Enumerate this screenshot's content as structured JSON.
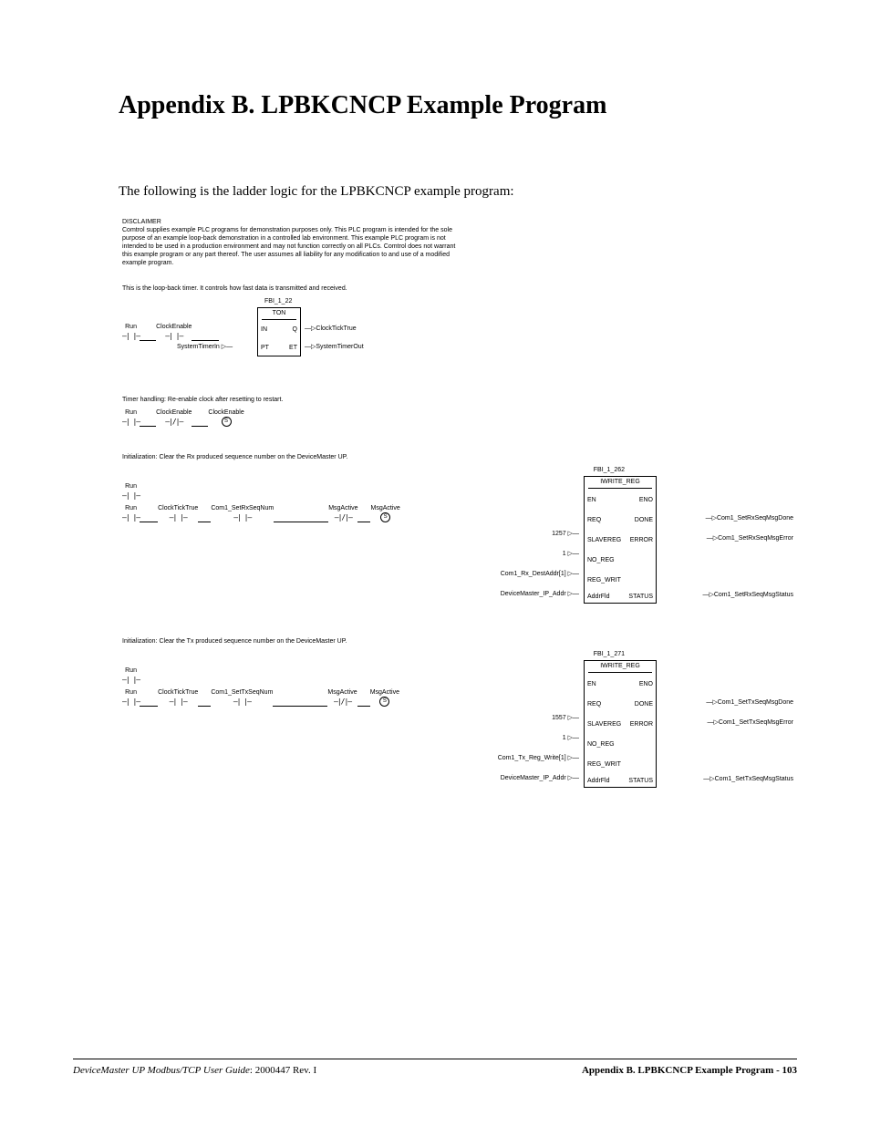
{
  "title": "Appendix B. LPBKCNCP Example Program",
  "intro": "The following is the ladder logic for the LPBKCNCP example program:",
  "disclaimer": {
    "heading": "DISCLAIMER",
    "body": "Comtrol supplies example PLC programs for demonstration purposes only. This PLC program is intended for the sole purpose of an example loop-back demonstration in a controlled lab environment. This example PLC program is not intended to be used in a production environment and may not function correctly on all PLCs. Comtrol does not warrant this example program or any part thereof. The user assumes all liability for any modification to and use of a modified example program."
  },
  "timer_rung": {
    "desc": "This is the loop-back timer. It controls how fast data is transmitted and received.",
    "fbi": "FBI_1_22",
    "type": "TON",
    "contacts": [
      "Run",
      "ClockEnable"
    ],
    "pins_left": [
      "IN",
      "PT"
    ],
    "pins_right": [
      "Q",
      "ET"
    ],
    "inputs_left_ext": [
      "SystemTimerIn"
    ],
    "outputs": [
      "ClockTickTrue",
      "SystemTimerOut"
    ]
  },
  "reset_rung": {
    "desc": "Timer handling: Re-enable clock after resetting to restart.",
    "contacts": [
      "Run",
      "ClockEnable"
    ],
    "neg": true,
    "coil_label": "ClockEnable",
    "coil_sym": "S"
  },
  "rx_init": {
    "desc": "Initialization: Clear the Rx produced sequence number on the DeviceMaster UP.",
    "fbi": "FBI_1_262",
    "fbtype": "IWRITE_REG",
    "top_contact": "Run",
    "contacts": [
      "Run",
      "ClockTickTrue",
      "Com1_SetRxSeqNum"
    ],
    "msg_active": "MsgActive",
    "msg_coil": "MsgActive",
    "left_literals": [
      "1257",
      "1"
    ],
    "left_vars": [
      "Com1_Rx_DestAddr[1]",
      "DeviceMaster_IP_Addr"
    ],
    "pins_left": [
      "EN",
      "REQ",
      "SLAVEREG",
      "NO_REG",
      "REG_WRIT",
      "AddrFld"
    ],
    "pins_right": [
      "ENO",
      "DONE",
      "ERROR",
      "",
      "",
      "STATUS"
    ],
    "outputs": [
      "",
      "Com1_SetRxSeqMsgDone",
      "Com1_SetRxSeqMsgError",
      "",
      "",
      "Com1_SetRxSeqMsgStatus"
    ]
  },
  "tx_init": {
    "desc": "Initialization: Clear the Tx produced sequence number on the DeviceMaster UP.",
    "fbi": "FBI_1_271",
    "fbtype": "IWRITE_REG",
    "top_contact": "Run",
    "contacts": [
      "Run",
      "ClockTickTrue",
      "Com1_SetTxSeqNum"
    ],
    "msg_active": "MsgActive",
    "msg_coil": "MsgActive",
    "left_literals": [
      "1557",
      "1"
    ],
    "left_vars": [
      "Com1_Tx_Reg_Write[1]",
      "DeviceMaster_IP_Addr"
    ],
    "pins_left": [
      "EN",
      "REQ",
      "SLAVEREG",
      "NO_REG",
      "REG_WRIT",
      "AddrFld"
    ],
    "pins_right": [
      "ENO",
      "DONE",
      "ERROR",
      "",
      "",
      "STATUS"
    ],
    "outputs": [
      "",
      "Com1_SetTxSeqMsgDone",
      "Com1_SetTxSeqMsgError",
      "",
      "",
      "Com1_SetTxSeqMsgStatus"
    ]
  },
  "footer": {
    "left_title": "DeviceMaster UP Modbus/TCP User Guide",
    "left_rev": ": 2000447 Rev. I",
    "right": "Appendix B. LPBKCNCP Example Program - 103"
  }
}
